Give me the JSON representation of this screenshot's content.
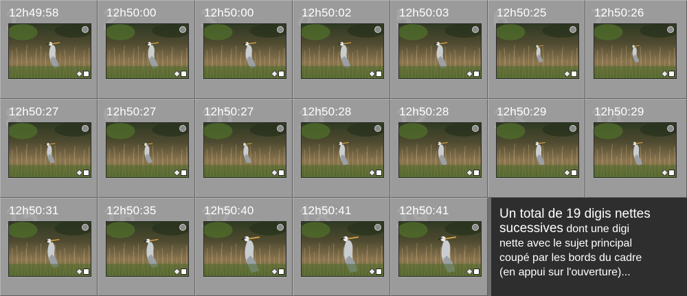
{
  "photos": [
    {
      "time": "12h49:58",
      "index": "1"
    },
    {
      "time": "12h50:00",
      "index": "2"
    },
    {
      "time": "12h50:00",
      "index": "3"
    },
    {
      "time": "12h50:02",
      "index": "4"
    },
    {
      "time": "12h50:03",
      "index": "5"
    },
    {
      "time": "12h50:25",
      "index": "6"
    },
    {
      "time": "12h50:26",
      "index": "7"
    },
    {
      "time": "12h50:27",
      "index": "8"
    },
    {
      "time": "12h50:27",
      "index": "9"
    },
    {
      "time": "12h50:27",
      "index": "10"
    },
    {
      "time": "12h50:28",
      "index": "11"
    },
    {
      "time": "12h50:28",
      "index": "12"
    },
    {
      "time": "12h50:29",
      "index": "13"
    },
    {
      "time": "12h50:29",
      "index": "14"
    },
    {
      "time": "12h50:31",
      "index": "15"
    },
    {
      "time": "12h50:35",
      "index": "16"
    },
    {
      "time": "12h50:40",
      "index": "17"
    },
    {
      "time": "12h50:41",
      "index": "18"
    },
    {
      "time": "12h50:41",
      "index": "19"
    }
  ],
  "note": {
    "line1": "Un total de 19 digis nettes",
    "line2_big": "sucessives",
    "line2_small": " dont une digi",
    "line3": "nette avec le sujet principal",
    "line4": "coupé par les bords du cadre",
    "line5": "(en appui sur l'ouverture)..."
  },
  "colors": {
    "cell_bg": "#9b9b9b",
    "note_bg": "#2e2e2e",
    "text": "#ffffff"
  },
  "icons": {
    "thumb_badge": "unflagged-dot-icon",
    "thumb_edit": "develop-adjusted-icon",
    "thumb_crop": "crop-icon"
  }
}
